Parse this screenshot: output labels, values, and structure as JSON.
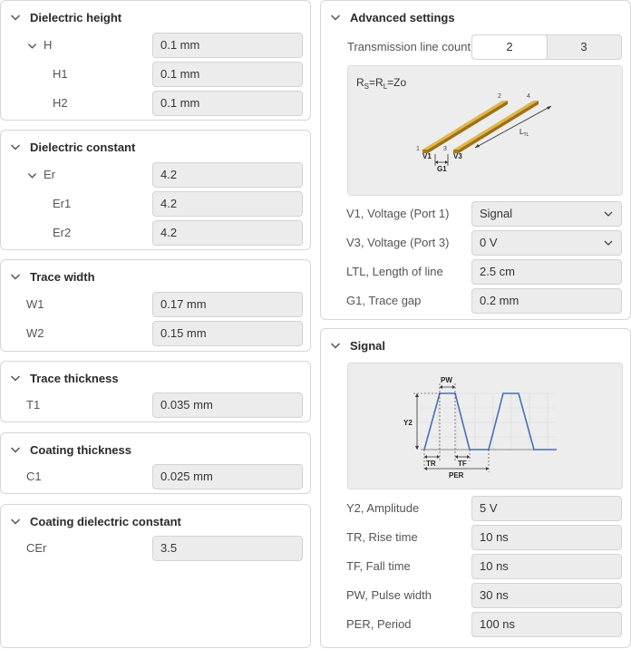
{
  "dielectric_height": {
    "title": "Dielectric height",
    "h_label": "H",
    "h_value": "0.1 mm",
    "h1_label": "H1",
    "h1_value": "0.1 mm",
    "h2_label": "H2",
    "h2_value": "0.1 mm"
  },
  "dielectric_constant": {
    "title": "Dielectric constant",
    "er_label": "Er",
    "er_value": "4.2",
    "er1_label": "Er1",
    "er1_value": "4.2",
    "er2_label": "Er2",
    "er2_value": "4.2"
  },
  "trace_width": {
    "title": "Trace width",
    "w1_label": "W1",
    "w1_value": "0.17 mm",
    "w2_label": "W2",
    "w2_value": "0.15 mm"
  },
  "trace_thickness": {
    "title": "Trace thickness",
    "t1_label": "T1",
    "t1_value": "0.035 mm"
  },
  "coating_thickness": {
    "title": "Coating thickness",
    "c1_label": "C1",
    "c1_value": "0.025 mm"
  },
  "coating_dielectric": {
    "title": "Coating dielectric constant",
    "cer_label": "CEr",
    "cer_value": "3.5"
  },
  "advanced": {
    "title": "Advanced settings",
    "tl_count_label": "Transmission line count",
    "tl_options": [
      "2",
      "3"
    ],
    "tl_selected": "2",
    "diagram": {
      "formula_rs": "R",
      "formula_rs_sub": "S",
      "formula_eq1": "=R",
      "formula_rl_sub": "L",
      "formula_eq2": "=Zo",
      "n1": "1",
      "n2": "2",
      "n3": "3",
      "n4": "4",
      "v1": "V1",
      "v3": "V3",
      "g1": "G1",
      "ltl": "L",
      "ltl_sub": "TL"
    },
    "v1_label": "V1, Voltage (Port 1)",
    "v1_value": "Signal",
    "v3_label": "V3, Voltage (Port 3)",
    "v3_value": "0 V",
    "ltl_label": "LTL, Length of line",
    "ltl_value": "2.5 cm",
    "g1_label": "G1, Trace gap",
    "g1_value": "0.2 mm"
  },
  "signal": {
    "title": "Signal",
    "diagram": {
      "pw": "PW",
      "y2": "Y2",
      "tr": "TR",
      "tf": "TF",
      "per": "PER"
    },
    "y2_label": "Y2, Amplitude",
    "y2_value": "5 V",
    "tr_label": "TR, Rise time",
    "tr_value": "10 ns",
    "tf_label": "TF, Fall time",
    "tf_value": "10 ns",
    "pw_label": "PW, Pulse width",
    "pw_value": "30 ns",
    "per_label": "PER, Period",
    "per_value": "100 ns"
  },
  "colors": {
    "trace_gold": "#c79a2a",
    "trace_dark": "#8a6414",
    "pulse_blue": "#4a6fb5"
  }
}
